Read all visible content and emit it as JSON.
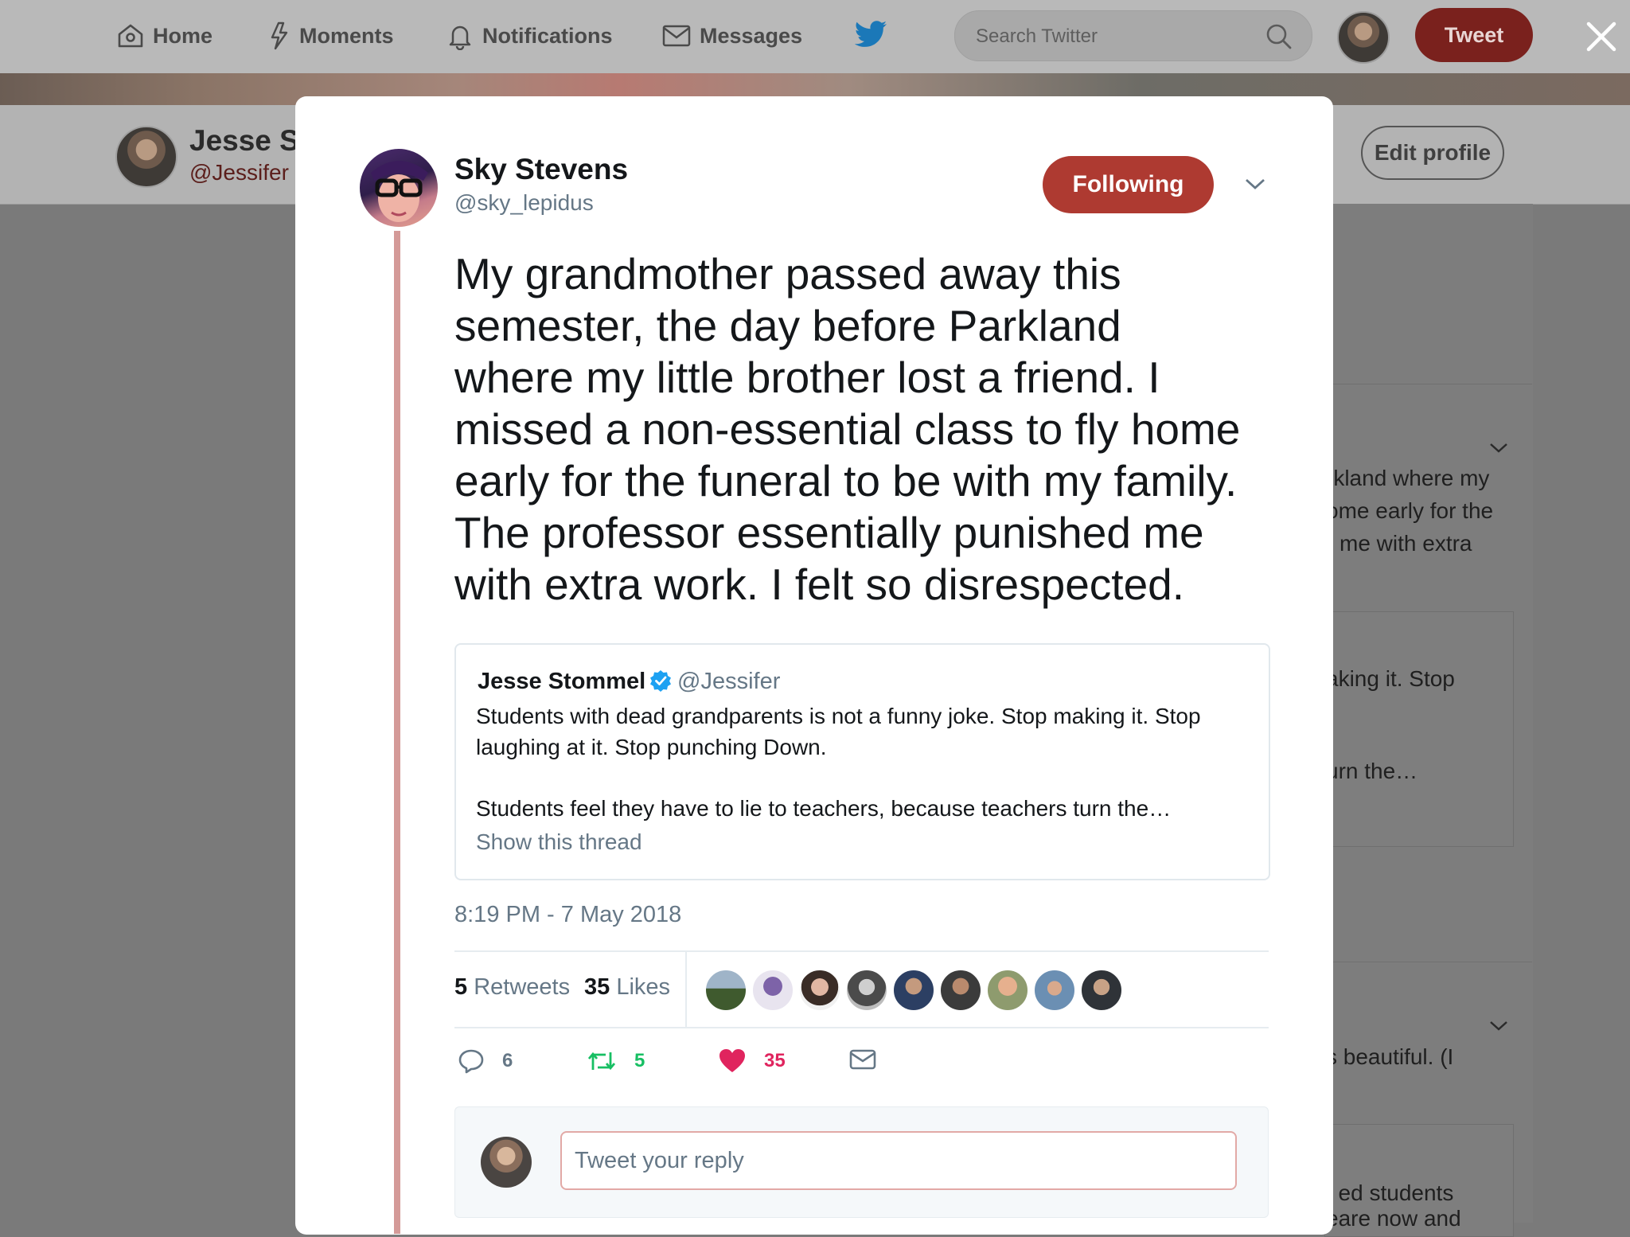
{
  "nav": {
    "home": "Home",
    "moments": "Moments",
    "notifications": "Notifications",
    "messages": "Messages",
    "search_placeholder": "Search Twitter",
    "tweet_button": "Tweet",
    "icons": [
      "home-icon",
      "lightning-icon",
      "bell-icon",
      "envelope-icon",
      "twitter-bird-icon",
      "search-icon",
      "close-icon"
    ]
  },
  "background_profile": {
    "name": "Jesse S",
    "handle": "@Jessifer",
    "edit_profile": "Edit profile",
    "snippets": [
      "rkland where my",
      "ome early for the",
      "me with extra",
      "aking it. Stop",
      "urn the…",
      "s beautiful. (I",
      "f ed students",
      "eare now and"
    ]
  },
  "tweet": {
    "author_name": "Sky Stevens",
    "author_handle": "@sky_lepidus",
    "follow_state": "Following",
    "text": "My grandmother passed away this\nsemester, the day before Parkland\nwhere my little brother lost a friend. I\nmissed a non-essential class to fly home\nearly for the funeral to be with my family.\nThe professor essentially punished me\nwith extra work. I felt so disrespected.",
    "quoted": {
      "name": "Jesse Stommel",
      "handle": "@Jessifer",
      "verified": true,
      "text1": "Students with dead grandparents is not a funny joke. Stop making it. Stop laughing at it. Stop punching Down.",
      "text2": "Students feel they have to lie to teachers, because teachers turn the…",
      "show_thread": "Show this thread"
    },
    "timestamp": "8:19 PM - 7 May 2018",
    "stats": {
      "retweets_count": "5",
      "retweets_label": "Retweets",
      "likes_count": "35",
      "likes_label": "Likes"
    },
    "likers_count": 9,
    "actions": {
      "replies": "6",
      "retweets": "5",
      "likes": "35"
    },
    "reply_placeholder": "Tweet your reply"
  },
  "colors": {
    "brand": "#ae3a31",
    "like": "#e0245e",
    "retweet": "#17bf63",
    "muted_text": "#657786",
    "verified": "#1da1f2"
  }
}
